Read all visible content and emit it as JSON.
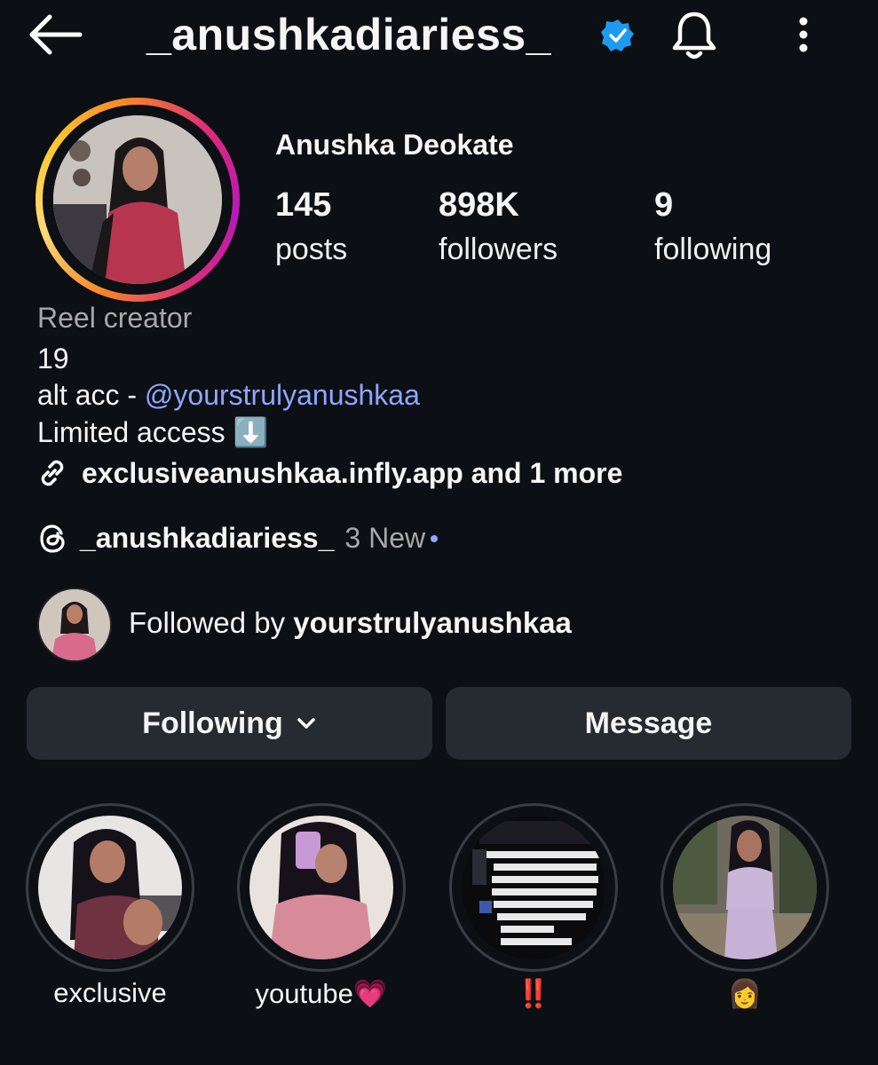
{
  "header": {
    "username": "_anushkadiariess_",
    "icons": [
      "back-arrow-icon",
      "verified-badge-icon",
      "bell-icon",
      "more-vertical-icon"
    ]
  },
  "profile": {
    "full_name": "Anushka Deokate",
    "stats": [
      {
        "value": "145",
        "label": "posts"
      },
      {
        "value": "898K",
        "label": "followers"
      },
      {
        "value": "9",
        "label": "following"
      }
    ],
    "category": "Reel creator",
    "bio_line1": "19",
    "bio_line2_prefix": "alt acc - ",
    "bio_line2_mention": "@yourstrulyanushkaa",
    "bio_line3": "Limited access ⬇️",
    "link_text": "exclusiveanushkaa.infly.app and 1 more",
    "threads_name": "_anushkadiariess_",
    "threads_new": "3 New",
    "followed_by_prefix": "Followed by ",
    "followed_by_user": "yourstrulyanushkaa"
  },
  "buttons": {
    "following": "Following",
    "message": "Message"
  },
  "highlights": [
    {
      "label": "exclusive"
    },
    {
      "label": "youtube💗"
    },
    {
      "label": "‼️"
    },
    {
      "label": "👩"
    }
  ],
  "colors": {
    "background": "#0c0f14",
    "button_bg": "#262a31",
    "mention": "#8fa6ff",
    "verified": "#1d9bf0",
    "secondary_text": "#a8a8a8"
  }
}
